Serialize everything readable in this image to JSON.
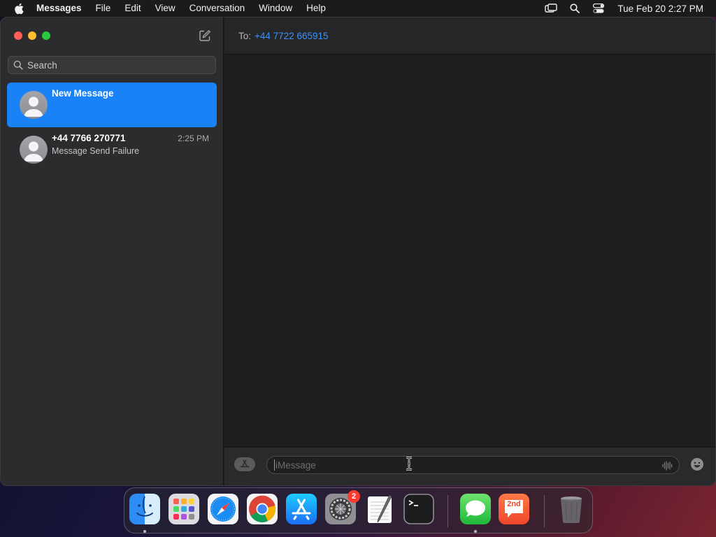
{
  "menubar": {
    "app_name": "Messages",
    "items": [
      "File",
      "Edit",
      "View",
      "Conversation",
      "Window",
      "Help"
    ],
    "clock": "Tue Feb 20  2:27 PM"
  },
  "sidebar": {
    "search_placeholder": "Search",
    "conversations": [
      {
        "name": "New Message",
        "preview": "",
        "time": ""
      },
      {
        "name": "+44 7766 270771",
        "preview": "Message Send Failure",
        "time": "2:25 PM"
      }
    ]
  },
  "main": {
    "to_label": "To:",
    "recipient": "+44 7722 665915",
    "message_placeholder": "iMessage"
  },
  "dock": {
    "apps": [
      "finder-icon",
      "launchpad-icon",
      "safari-icon",
      "chrome-icon",
      "app-store-icon",
      "system-settings-icon",
      "textedit-icon",
      "terminal-icon",
      "messages-icon",
      "2nd-line-icon",
      "trash-icon"
    ],
    "settings_badge": "2",
    "second_line_label": "2nd"
  },
  "colors": {
    "accent": "#1a82f7",
    "link": "#3b93ff"
  }
}
